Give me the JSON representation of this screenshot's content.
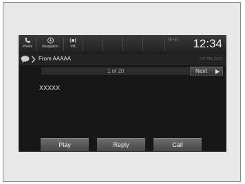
{
  "statusbar": {
    "phone_label": "Phone",
    "navigation_label": "Navigation",
    "fm_label": "FM",
    "indicators": "(( ▪ ))",
    "clock": "12:34"
  },
  "header": {
    "title": "From AAAAA",
    "timestamp": "2:37 PM, 01/11"
  },
  "pager": {
    "indicator": "1 of 20",
    "next_label": "Next"
  },
  "message": {
    "body": "XXXXX"
  },
  "softkeys": {
    "play_label": "Play",
    "reply_label": "Reply",
    "call_label": "Call"
  },
  "icons": {
    "phone": "phone-icon",
    "navigation": "navigation-icon",
    "fm": "fm-icon",
    "message": "message-bubble-icon",
    "chevron": "chevron-right-icon",
    "next": "play-arrow-icon"
  }
}
